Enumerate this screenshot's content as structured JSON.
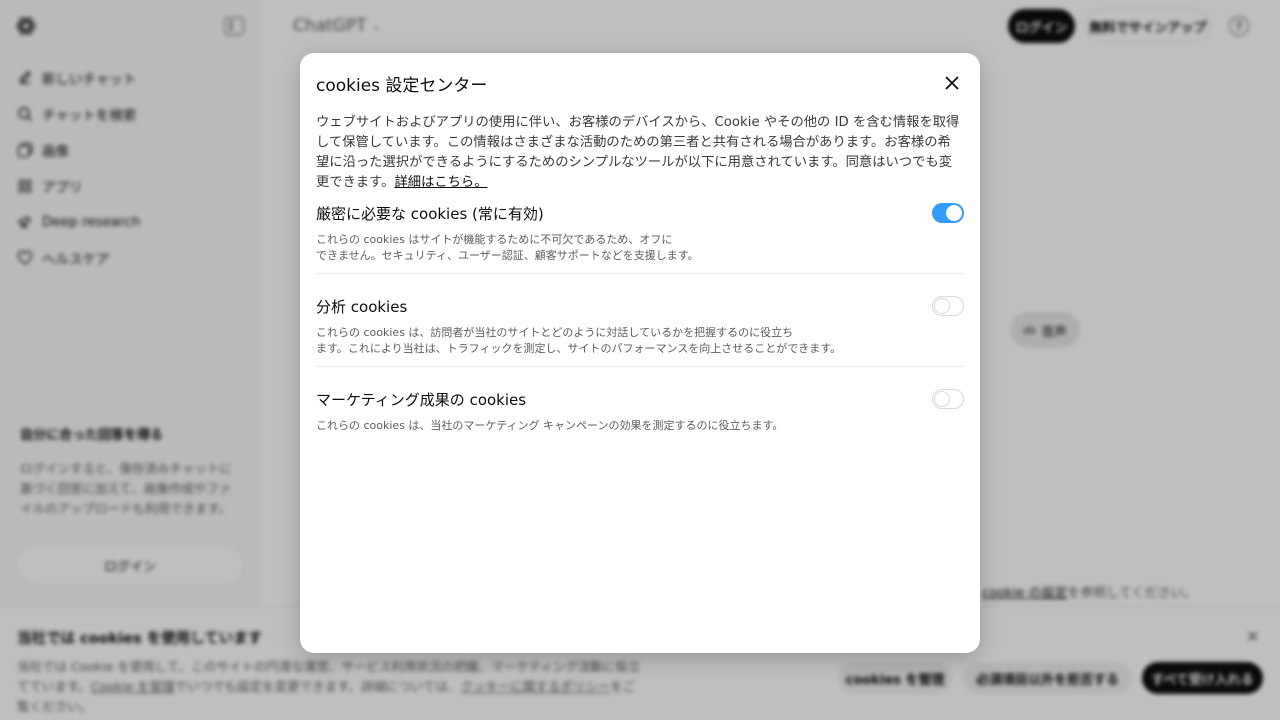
{
  "sidebar": {
    "nav": [
      {
        "label": "新しいチャット",
        "icon": "edit-icon"
      },
      {
        "label": "チャットを検索",
        "icon": "search-icon"
      },
      {
        "label": "画像",
        "icon": "image-icon"
      },
      {
        "label": "アプリ",
        "icon": "apps-icon"
      },
      {
        "label": "Deep research",
        "icon": "telescope-icon"
      },
      {
        "label": "ヘルスケア",
        "icon": "heart-icon"
      }
    ],
    "promo_title": "自分に合った回答を得る",
    "promo_text": "ログインすると、保存済みチャットに基づく回答に加えて、画像作成やファイルのアップロードも利用できます。",
    "promo_login": "ログイン"
  },
  "header": {
    "title": "ChatGPT",
    "login": "ログイン",
    "signup": "無料でサインアップ",
    "help": "?"
  },
  "main": {
    "voice": "音声",
    "cookie_note_link": "cookie の設定",
    "cookie_note_rest": "を参照してください。"
  },
  "banner": {
    "title": "当社では cookies を使用しています",
    "text_1": "当社では Cookie を使用して、このサイトの円滑な運営、サービス利用状況の把握、マーケティング活動に役立てています。",
    "link_1": "Cookie を管理",
    "text_2": "でいつでも設定を変更できます。詳細については、",
    "link_2": "クッキーに関するポリシー",
    "text_3": "をご覧ください。",
    "btn_manage": "cookies を管理",
    "btn_reject": "必須項目以外を拒否する",
    "btn_accept": "すべて受け入れる"
  },
  "modal": {
    "title": "cookies 設定センター",
    "description": "ウェブサイトおよびアプリの使用に伴い、お客様のデバイスから、Cookie やその他の ID を含む情報を取得して保管しています。この情報はさまざまな活動のための第三者と共有される場合があります。お客様の希望に沿った選択ができるようにするためのシンプルなツールが以下に用意されています。同意はいつでも変更できます。",
    "details_link": "詳細はこちら。",
    "sections": [
      {
        "title": "厳密に必要な cookies (常に有効)",
        "desc_1": "これらの cookies はサイトが機能するために不可欠であるため、オフに",
        "desc_2": "できません。セキュリティ、ユーザー認証、顧客サポートなどを支援します。",
        "enabled": true
      },
      {
        "title": "分析 cookies",
        "desc_1": "これらの cookies は、訪問者が当社のサイトとどのように対話しているかを把握するのに役立ち",
        "desc_2": "ます。これにより当社は、トラフィックを測定し、サイトのパフォーマンスを向上させることができます。",
        "enabled": false
      },
      {
        "title": "マーケティング成果の cookies",
        "desc_1": "これらの cookies は、当社のマーケティング キャンペーンの効果を測定するのに役立ちます。",
        "desc_2": "",
        "enabled": false
      }
    ]
  }
}
